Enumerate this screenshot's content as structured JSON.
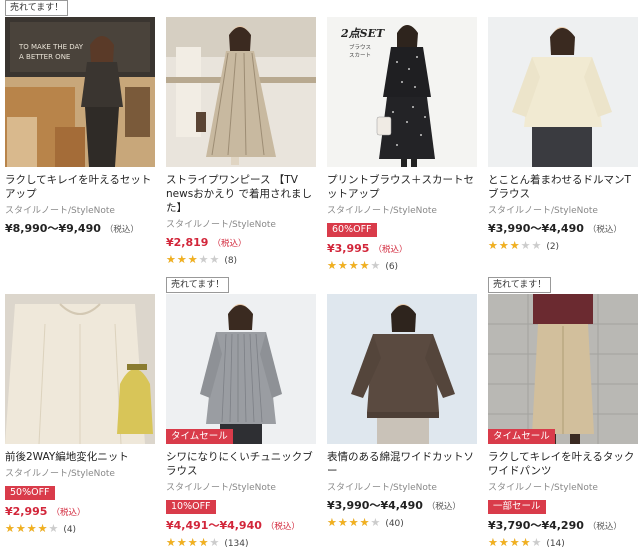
{
  "products": [
    {
      "badge": "売れてます！",
      "name": "ラクしてキレイを叶えるセットアップ",
      "brand": "スタイルノート/StyleNote",
      "price": "¥8,990〜¥9,490",
      "price_color": "black",
      "tax": "（税込）",
      "off_label": null,
      "sale_label": null,
      "rating": null,
      "review_count": null,
      "photo_text_1": "TO MAKE THE DAY",
      "photo_text_2": "A BETTER ONE"
    },
    {
      "badge": null,
      "name": "ストライプワンピース 【TV newsおかえり で着用されました】",
      "brand": "スタイルノート/StyleNote",
      "price": "¥2,819",
      "price_color": "red",
      "tax": "（税込）",
      "off_label": null,
      "sale_label": null,
      "rating": 0.6,
      "review_count": "(8)"
    },
    {
      "badge": null,
      "name": "プリントブラウス＋スカートセットアップ",
      "brand": "スタイルノート/StyleNote",
      "price": "¥3,995",
      "price_color": "red",
      "tax": "（税込）",
      "off_label": "60%OFF",
      "sale_label": null,
      "rating": 0.8,
      "review_count": "(6)",
      "photo_text_1": "2点SET",
      "photo_text_2": "ブラウス",
      "photo_text_3": "スカート"
    },
    {
      "badge": null,
      "name": "とことん着まわせるドルマンTブラウス",
      "brand": "スタイルノート/StyleNote",
      "price": "¥3,990〜¥4,490",
      "price_color": "black",
      "tax": "（税込）",
      "off_label": null,
      "sale_label": null,
      "rating": 0.6,
      "review_count": "(2)"
    },
    {
      "badge": null,
      "name": "前後2WAY編地変化ニット",
      "brand": "スタイルノート/StyleNote",
      "price": "¥2,995",
      "price_color": "red",
      "tax": "（税込）",
      "off_label": "50%OFF",
      "sale_label": null,
      "rating": 0.8,
      "review_count": "(4)"
    },
    {
      "badge": "売れてます！",
      "name": "シワになりにくいチュニックブラウス",
      "brand": "スタイルノート/StyleNote",
      "price": "¥4,491〜¥4,940",
      "price_color": "red",
      "tax": "（税込）",
      "off_label": "10%OFF",
      "sale_label": "タイムセール",
      "rating": 0.8,
      "review_count": "(134)"
    },
    {
      "badge": null,
      "name": "表情のある綿混ワイドカットソー",
      "brand": "スタイルノート/StyleNote",
      "price": "¥3,990〜¥4,490",
      "price_color": "black",
      "tax": "（税込）",
      "off_label": null,
      "sale_label": null,
      "rating": 0.8,
      "review_count": "(40)"
    },
    {
      "badge": "売れてます！",
      "name": "ラクしてキレイを叶えるタックワイドパンツ",
      "brand": "スタイルノート/StyleNote",
      "price": "¥3,790〜¥4,290",
      "price_color": "black",
      "tax": "（税込）",
      "off_label": "一部セール",
      "sale_label": "タイムセール",
      "rating": 0.8,
      "review_count": "(14)"
    }
  ],
  "colors": {
    "accent_red": "#d93b4a",
    "price_red": "#d2263a",
    "star_gold": "#f2b01e"
  }
}
